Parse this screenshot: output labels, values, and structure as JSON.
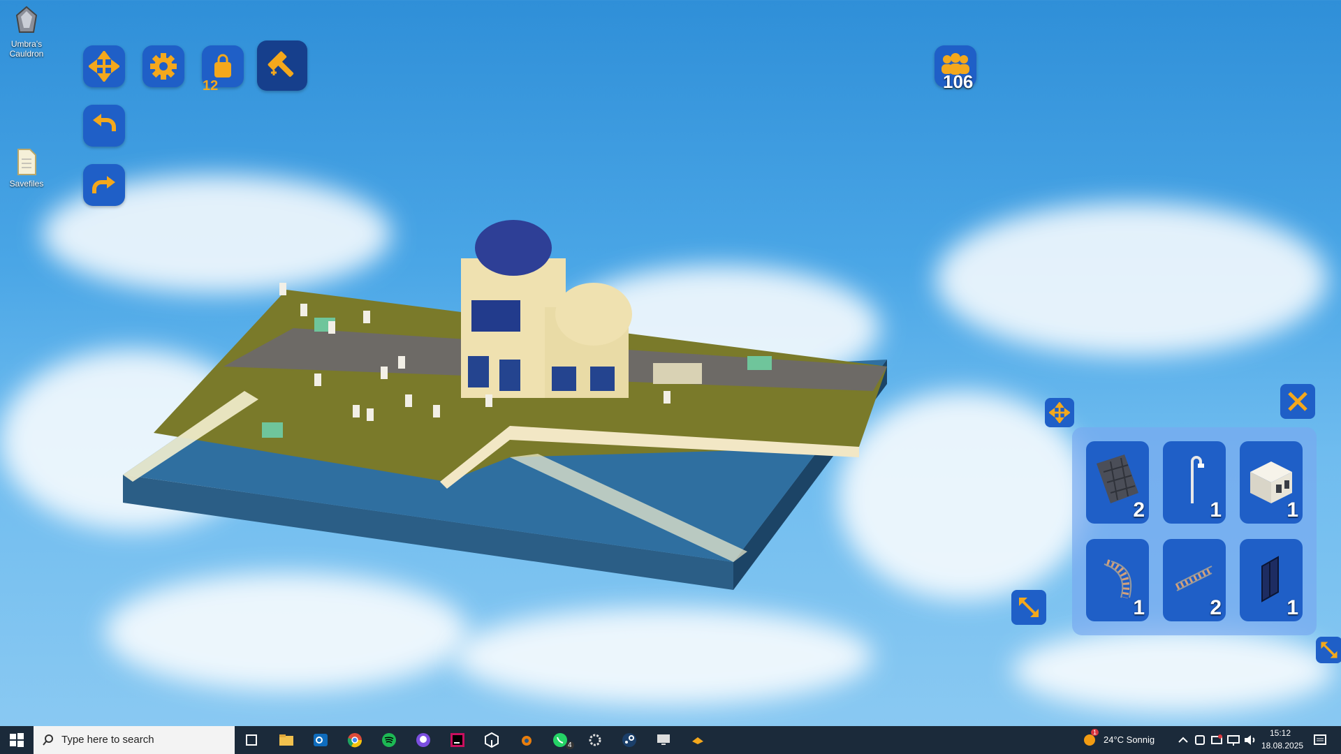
{
  "desktop": {
    "icons": [
      {
        "label_line1": "Umbra's",
        "label_line2": "Cauldron"
      },
      {
        "label_line1": "Savefiles",
        "label_line2": ""
      }
    ]
  },
  "game": {
    "bag_count": "12",
    "population": "106",
    "inventory": [
      {
        "icon": "stone-tile-icon",
        "count": "2"
      },
      {
        "icon": "street-lamp-icon",
        "count": "1"
      },
      {
        "icon": "house-block-icon",
        "count": "1"
      },
      {
        "icon": "curved-rail-icon",
        "count": "1"
      },
      {
        "icon": "straight-rail-icon",
        "count": "2"
      },
      {
        "icon": "window-panel-icon",
        "count": "1"
      }
    ]
  },
  "taskbar": {
    "search_placeholder": "Type here to search",
    "whatsapp_badge": "4",
    "weather_badge": "1",
    "weather": "24°C  Sonnig",
    "time": "15:12",
    "date": "18.08.2025"
  },
  "colors": {
    "button_blue": "#1f5fc7",
    "accent_orange": "#f4a81c"
  }
}
